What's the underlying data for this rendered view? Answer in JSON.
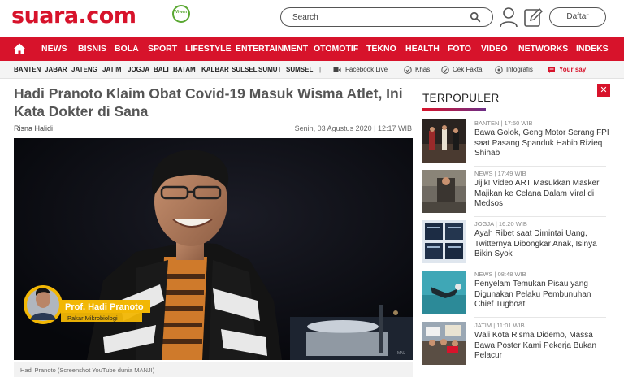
{
  "header": {
    "logo_text": "suara.com",
    "badge_text": "Viwen",
    "search_placeholder": "Search",
    "daftar_label": "Daftar"
  },
  "main_nav": [
    "NEWS",
    "BISNIS",
    "BOLA",
    "SPORT",
    "LIFESTYLE",
    "ENTERTAINMENT",
    "OTOMOTIF",
    "TEKNO",
    "HEALTH",
    "FOTO",
    "VIDEO",
    "NETWORKS",
    "INDEKS"
  ],
  "sub_nav": {
    "regions": [
      "BANTEN",
      "JABAR",
      "JATENG",
      "JATIM",
      "JOGJA",
      "BALI",
      "BATAM",
      "KALBAR",
      "SULSEL",
      "SUMUT",
      "SUMSEL"
    ],
    "separator": "|",
    "features": [
      "Facebook Live",
      "Khas",
      "Cek Fakta",
      "Infografis"
    ],
    "your_say": "Your say"
  },
  "article": {
    "title": "Hadi Pranoto Klaim Obat Covid-19 Masuk Wisma Atlet, Ini Kata Dokter di Sana",
    "author": "Risna Halidi",
    "date": "Senin, 03 Agustus 2020 | 12:17 WIB",
    "photo_name": "Prof. Hadi Pranoto",
    "photo_role": "Pakar Mikrobiologi",
    "photo_watermark": "MNJ",
    "caption": "Hadi Pranoto (Screenshot YouTube dunia MANJI)"
  },
  "sidebar": {
    "title": "TERPOPULER",
    "close_label": "✕",
    "items": [
      {
        "meta": "BANTEN | 17:50 WIB",
        "headline": "Bawa Golok, Geng Motor Serang FPI saat Pasang Spanduk Habib Rizieq Shihab"
      },
      {
        "meta": "NEWS | 17:49 WIB",
        "headline": "Jijik! Video ART Masukkan Masker Majikan ke Celana Dalam Viral di Medsos"
      },
      {
        "meta": "JOGJA | 16:20 WIB",
        "headline": "Ayah Ribet saat Dimintai Uang, Twitternya Dibongkar Anak, Isinya Bikin Syok"
      },
      {
        "meta": "NEWS | 08:48 WIB",
        "headline": "Penyelam Temukan Pisau yang Digunakan Pelaku Pembunuhan Chief Tugboat"
      },
      {
        "meta": "JATIM | 11:01 WIB",
        "headline": "Wali Kota Risma Didemo, Massa Bawa Poster Kami Pekerja Bukan Pelacur"
      }
    ]
  },
  "colors": {
    "brand_red": "#d7132b",
    "accent_purple": "#6b2d86"
  },
  "icons": [
    "search-icon",
    "user-icon",
    "edit-icon",
    "home-icon",
    "video-icon",
    "check-icon",
    "info-icon",
    "chat-icon",
    "close-icon"
  ]
}
